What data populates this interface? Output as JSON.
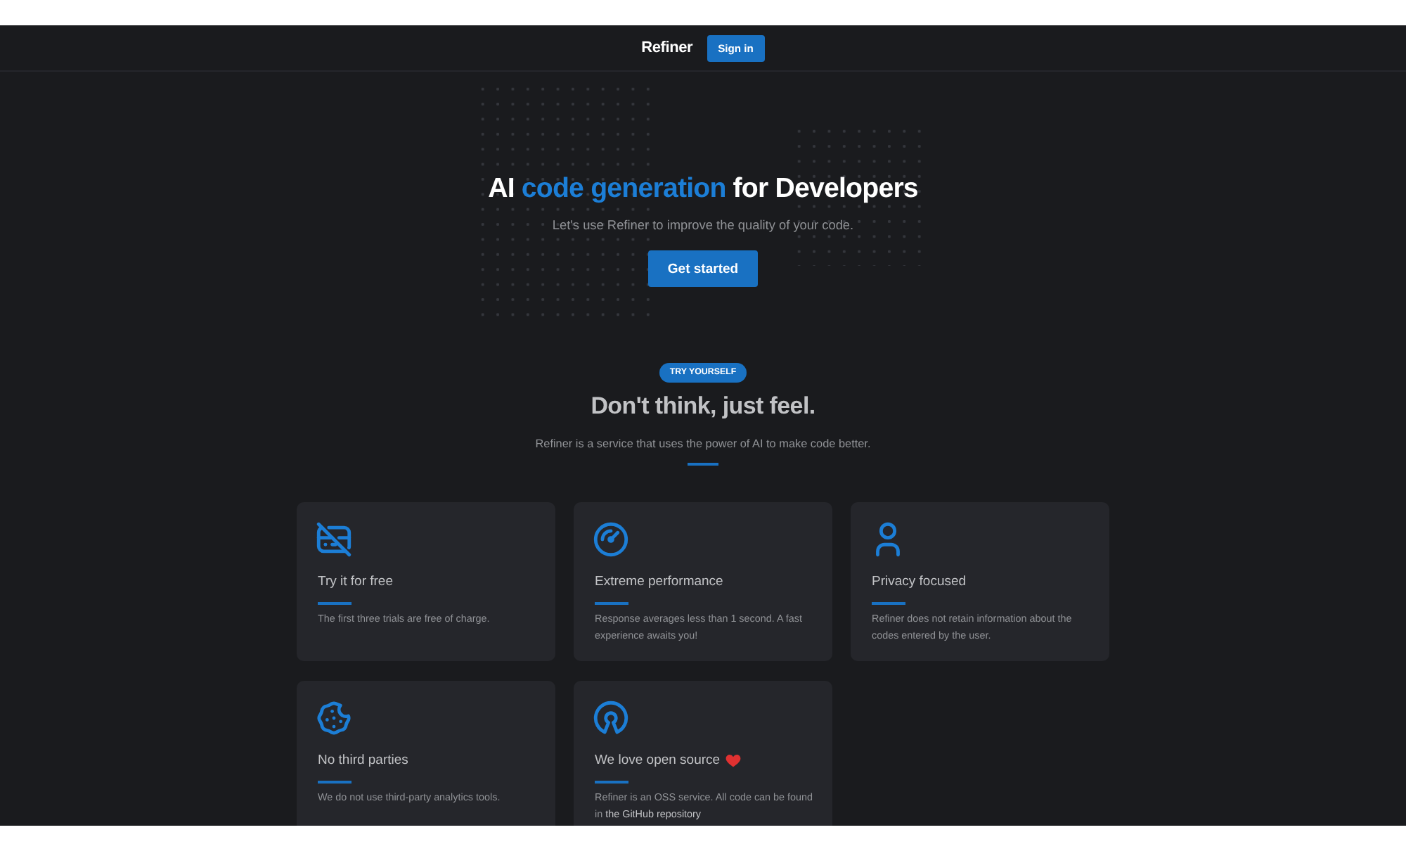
{
  "header": {
    "brand": "Refiner",
    "sign_in": "Sign in"
  },
  "hero": {
    "title_parts": [
      {
        "text": "AI ",
        "highlight": false
      },
      {
        "text": "code generation",
        "highlight": true
      },
      {
        "text": " for Developers",
        "highlight": false
      }
    ],
    "subtitle": "Let's use Refiner to improve the quality of your code.",
    "cta": "Get started"
  },
  "features": {
    "badge": "TRY YOURSELF",
    "title": "Don't think, just feel.",
    "description": "Refiner is a service that uses the power of AI to make code better.",
    "cards": [
      {
        "title": "Try it for free",
        "description": "The first three trials are free of charge."
      },
      {
        "title": "Extreme performance",
        "description": "Response averages less than 1 second. A fast experience awaits you!"
      },
      {
        "title": "Privacy focused",
        "description": "Refiner does not retain information about the codes entered by the user."
      },
      {
        "title": "No third parties",
        "description": "We do not use third-party analytics tools."
      },
      {
        "title": "We love open source",
        "description": "Refiner is an OSS service. All code can be found in",
        "link": "the GitHub repository"
      }
    ]
  }
}
